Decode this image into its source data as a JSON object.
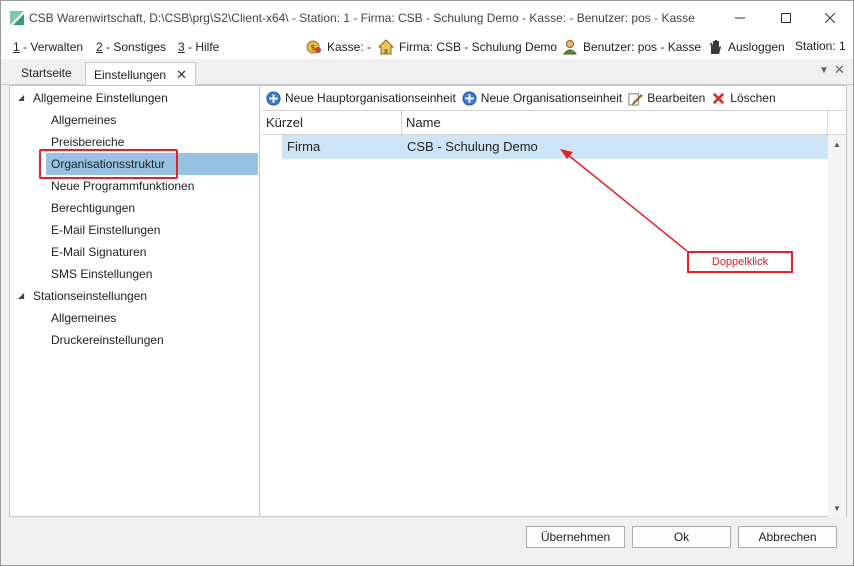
{
  "window": {
    "title": "CSB Warenwirtschaft, D:\\CSB\\prg\\S2\\Client-x64\\ - Station: 1 - Firma: CSB - Schulung Demo - Kasse:  - Benutzer: pos - Kasse",
    "minimize_icon": "minimize-icon",
    "maximize_icon": "maximize-icon",
    "close_icon": "close-icon"
  },
  "menu": {
    "items": [
      {
        "key": "1",
        "label": " - Verwalten"
      },
      {
        "key": "2",
        "label": " - Sonstiges"
      },
      {
        "key": "3",
        "label": " - Hilfe"
      }
    ]
  },
  "status": {
    "kasse": "Kasse: -",
    "firma": "Firma: CSB - Schulung Demo",
    "benutzer": "Benutzer: pos - Kasse",
    "logout": "Ausloggen",
    "station": "Station: 1"
  },
  "tabs": [
    {
      "label": "Startseite",
      "active": false
    },
    {
      "label": "Einstellungen",
      "active": true
    }
  ],
  "tree": {
    "groups": [
      {
        "label": "Allgemeine Einstellungen",
        "children": [
          "Allgemeines",
          "Preisbereiche",
          "Organisationsstruktur",
          "Neue Programmfunktionen",
          "Berechtigungen",
          "E-Mail Einstellungen",
          "E-Mail Signaturen",
          "SMS Einstellungen"
        ]
      },
      {
        "label": "Stationseinstellungen",
        "children": [
          "Allgemeines",
          "Druckereinstellungen"
        ]
      }
    ],
    "selected": "Organisationsstruktur"
  },
  "toolbar": {
    "new_main_unit": "Neue Hauptorganisationseinheit",
    "new_unit": "Neue Organisationseinheit",
    "edit": "Bearbeiten",
    "delete": "Löschen"
  },
  "grid": {
    "columns": [
      "Kürzel",
      "Name"
    ],
    "rows": [
      {
        "kuerzel": "Firma",
        "name": "CSB - Schulung Demo"
      }
    ]
  },
  "annotation": {
    "text": "Doppelklick",
    "color": "#e0242b"
  },
  "buttons": {
    "apply": "Übernehmen",
    "ok": "Ok",
    "cancel": "Abbrechen"
  },
  "colors": {
    "selection": "#99c2e2",
    "row_highlight": "#cde5f7",
    "accent_red": "#e0242b"
  }
}
